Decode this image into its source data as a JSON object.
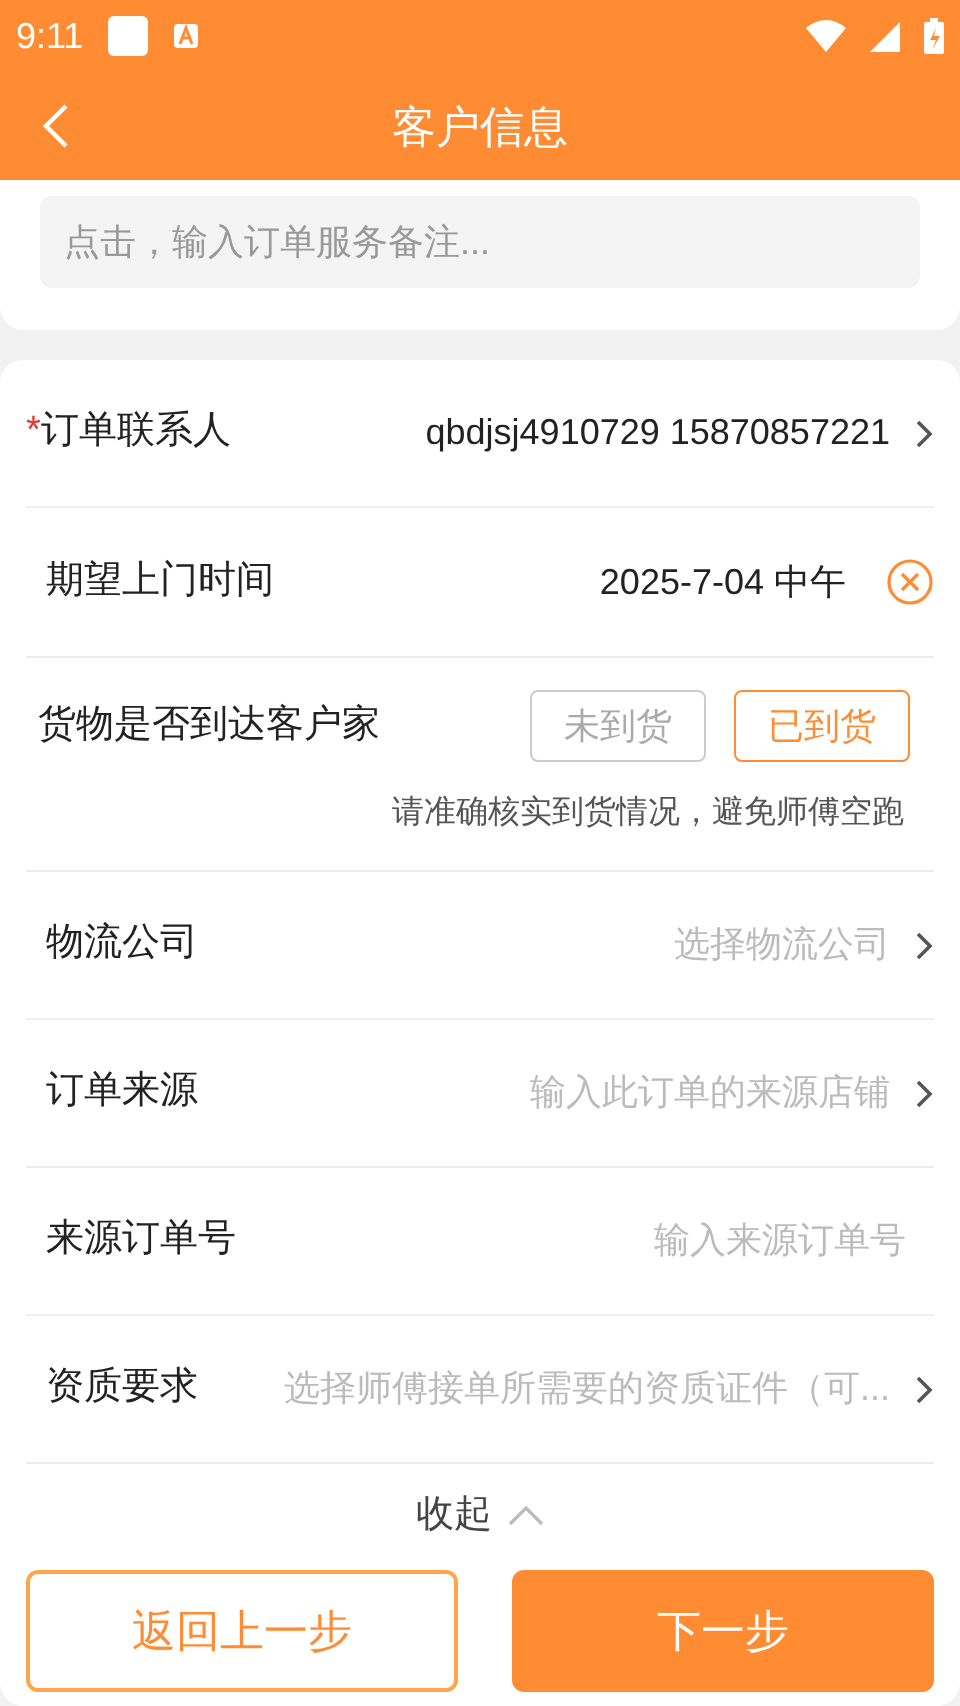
{
  "status_bar": {
    "time": "9:11"
  },
  "app_bar": {
    "title": "客户信息"
  },
  "remark": {
    "placeholder": "点击，输入订单服务备注..."
  },
  "rows": [
    {
      "kind": "select",
      "label": "订单联系人",
      "required": true,
      "value": "qbdjsj4910729 15870857221"
    },
    {
      "kind": "clearable",
      "label": "期望上门时间",
      "required": false,
      "value": "2025-7-04 中午"
    },
    {
      "kind": "toggle",
      "label": "货物是否到达客户家",
      "required": false,
      "options": [
        {
          "label": "未到货",
          "selected": false
        },
        {
          "label": "已到货",
          "selected": true
        }
      ],
      "hint": "请准确核实到货情况，避免师傅空跑"
    },
    {
      "kind": "select",
      "label": "物流公司",
      "required": false,
      "placeholder": "选择物流公司"
    },
    {
      "kind": "select",
      "label": "订单来源",
      "required": false,
      "placeholder": "输入此订单的来源店铺"
    },
    {
      "kind": "input",
      "label": "来源订单号",
      "required": false,
      "placeholder": "输入来源订单号"
    },
    {
      "kind": "select",
      "label": "资质要求",
      "required": false,
      "placeholder": "选择师傅接单所需要的资质证件（可..."
    }
  ],
  "required_mark": "*",
  "collapse": {
    "label": "收起"
  },
  "buttons": {
    "back": "返回上一步",
    "next": "下一步"
  }
}
